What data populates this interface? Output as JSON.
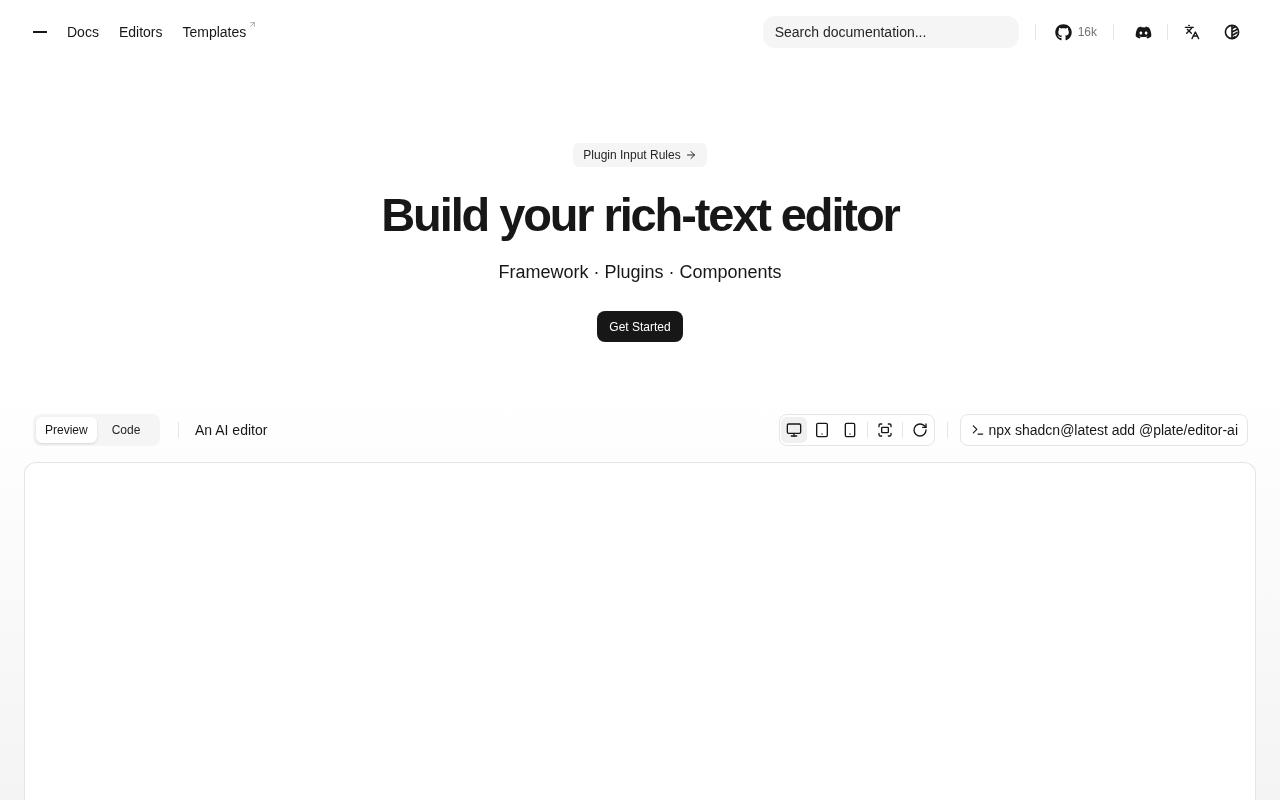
{
  "header": {
    "nav": [
      {
        "label": "Docs",
        "external": false
      },
      {
        "label": "Editors",
        "external": false
      },
      {
        "label": "Templates",
        "external": true
      }
    ],
    "search": {
      "placeholder": "Search documentation..."
    },
    "github_stars": "16k"
  },
  "hero": {
    "badge": "Plugin Input Rules",
    "title": "Build your rich-text editor",
    "subtitle": "Framework · Plugins · Components",
    "cta": "Get Started"
  },
  "demo": {
    "tabs": [
      {
        "label": "Preview",
        "selected": true
      },
      {
        "label": "Code",
        "selected": false
      }
    ],
    "title": "An AI editor",
    "view_modes": [
      {
        "kind": "desktop",
        "selected": true
      },
      {
        "kind": "tablet",
        "selected": false
      },
      {
        "kind": "mobile",
        "selected": false
      }
    ],
    "actions": [
      {
        "kind": "fullscreen"
      },
      {
        "kind": "refresh"
      }
    ],
    "command": "npx shadcn@latest add @plate/editor-ai"
  }
}
